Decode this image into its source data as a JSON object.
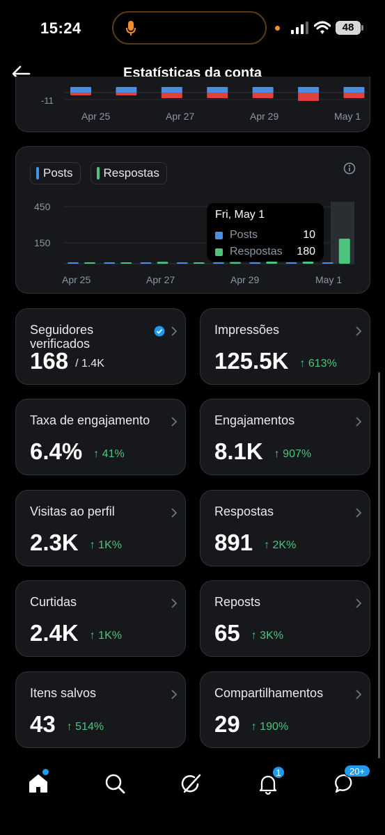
{
  "status_bar": {
    "time": "15:24",
    "battery": "48",
    "icons": [
      "mic-icon",
      "signal-icon",
      "wifi-icon",
      "battery-icon"
    ],
    "recording_dot_color": "#f0902c"
  },
  "header": {
    "title": "Estatísticas da conta",
    "back_icon": "arrow-left-icon"
  },
  "colors": {
    "posts": "#4a8fe7",
    "respostas": "#4cc47e",
    "negative": "#e0413f",
    "positive_change": "#4cc47e",
    "card_bg": "#16181c",
    "accent": "#1d9bf0"
  },
  "chart_data": [
    {
      "type": "bar",
      "note_partial": true,
      "tick_y": "-11",
      "x_labels": [
        "Apr 25",
        "Apr 27",
        "Apr 29",
        "May 1"
      ],
      "categories": [
        "Apr 25",
        "Apr 26",
        "Apr 27",
        "Apr 28",
        "Apr 29",
        "Apr 30",
        "May 1"
      ],
      "series": [
        {
          "color": "#4a8fe7",
          "values": [
            2,
            2,
            2,
            2,
            2,
            2,
            2
          ]
        },
        {
          "color": "#e0413f",
          "values": [
            -1,
            -1,
            -2,
            -2,
            -2,
            -3,
            -2
          ]
        }
      ]
    },
    {
      "type": "bar",
      "categories": [
        "Apr 24",
        "Apr 25",
        "Apr 26",
        "Apr 27",
        "Apr 28",
        "Apr 29",
        "Apr 30",
        "May 1"
      ],
      "x_labels": [
        "Apr 25",
        "Apr 27",
        "Apr 29",
        "May 1"
      ],
      "y_ticks": [
        "450",
        "150"
      ],
      "ylim": [
        0,
        500
      ],
      "legend": [
        "Posts",
        "Respostas"
      ],
      "series": [
        {
          "name": "Posts",
          "color": "#4a8fe7",
          "values": [
            6,
            5,
            6,
            7,
            7,
            8,
            9,
            10
          ]
        },
        {
          "name": "Respostas",
          "color": "#4cc47e",
          "values": [
            6,
            5,
            14,
            10,
            12,
            15,
            15,
            180
          ]
        }
      ],
      "tooltip": {
        "date": "Fri, May 1",
        "rows": [
          {
            "name": "Posts",
            "value": "10"
          },
          {
            "name": "Respostas",
            "value": "180"
          }
        ]
      }
    }
  ],
  "metrics": [
    {
      "label": "Seguidores verificados",
      "value": "168",
      "sub": "/ 1.4K",
      "verified": true
    },
    {
      "label": "Impressões",
      "value": "125.5K",
      "change": "613%"
    },
    {
      "label": "Taxa de engajamento",
      "value": "6.4%",
      "change": "41%"
    },
    {
      "label": "Engajamentos",
      "value": "8.1K",
      "change": "907%"
    },
    {
      "label": "Visitas ao perfil",
      "value": "2.3K",
      "change": "1K%"
    },
    {
      "label": "Respostas",
      "value": "891",
      "change": "2K%"
    },
    {
      "label": "Curtidas",
      "value": "2.4K",
      "change": "1K%"
    },
    {
      "label": "Reposts",
      "value": "65",
      "change": "3K%"
    },
    {
      "label": "Itens salvos",
      "value": "43",
      "change": "514%"
    },
    {
      "label": "Compartilhamentos",
      "value": "29",
      "change": "190%"
    }
  ],
  "tabbar": {
    "items": [
      "home-icon",
      "search-icon",
      "grok-icon",
      "bell-icon",
      "messages-icon"
    ],
    "notifications_badge": "1",
    "messages_badge": "20+"
  }
}
